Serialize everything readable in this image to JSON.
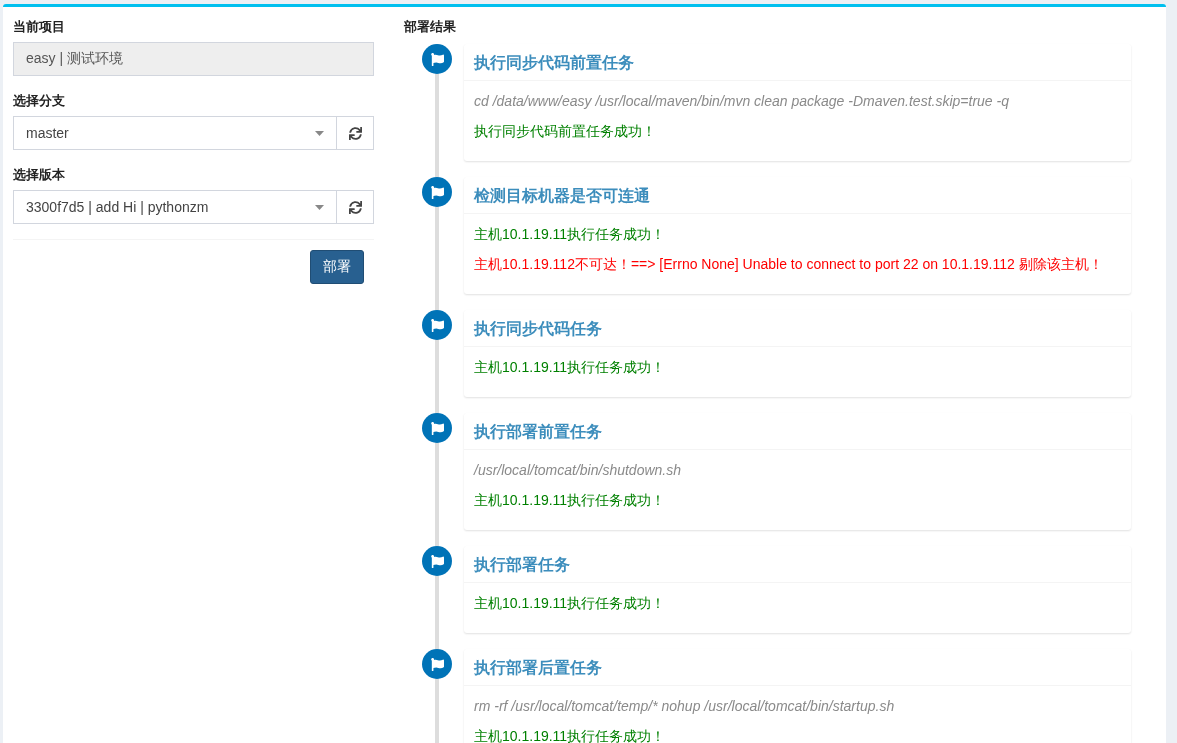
{
  "project_form": {
    "fields": [
      {
        "label": "当前项目",
        "kind": "text",
        "value": "easy | 测试环境",
        "disabled": true
      },
      {
        "label": "选择分支",
        "kind": "select",
        "value": "master",
        "disabled": false
      },
      {
        "label": "选择版本",
        "kind": "select",
        "value": "3300f7d5 | add Hi | pythonzm",
        "disabled": false
      }
    ],
    "deploy_button": "部署"
  },
  "results": {
    "title": "部署结果",
    "steps": [
      {
        "title": "执行同步代码前置任务",
        "lines": [
          {
            "kind": "command",
            "text": "cd /data/www/easy /usr/local/maven/bin/mvn clean package -Dmaven.test.skip=true -q"
          },
          {
            "kind": "success",
            "text": "执行同步代码前置任务成功！"
          }
        ]
      },
      {
        "title": "检测目标机器是否可连通",
        "lines": [
          {
            "kind": "success",
            "text": "主机10.1.19.11执行任务成功！"
          },
          {
            "kind": "error",
            "text": "主机10.1.19.112不可达！==> [Errno None] Unable to connect to port 22 on 10.1.19.112 剔除该主机！"
          }
        ]
      },
      {
        "title": "执行同步代码任务",
        "lines": [
          {
            "kind": "success",
            "text": "主机10.1.19.11执行任务成功！"
          }
        ]
      },
      {
        "title": "执行部署前置任务",
        "lines": [
          {
            "kind": "command",
            "text": "/usr/local/tomcat/bin/shutdown.sh"
          },
          {
            "kind": "success",
            "text": "主机10.1.19.11执行任务成功！"
          }
        ]
      },
      {
        "title": "执行部署任务",
        "lines": [
          {
            "kind": "success",
            "text": "主机10.1.19.11执行任务成功！"
          }
        ]
      },
      {
        "title": "执行部署后置任务",
        "lines": [
          {
            "kind": "command",
            "text": "rm -rf /usr/local/tomcat/temp/* nohup /usr/local/tomcat/bin/startup.sh"
          },
          {
            "kind": "success",
            "text": "主机10.1.19.11执行任务成功！"
          }
        ]
      }
    ]
  }
}
